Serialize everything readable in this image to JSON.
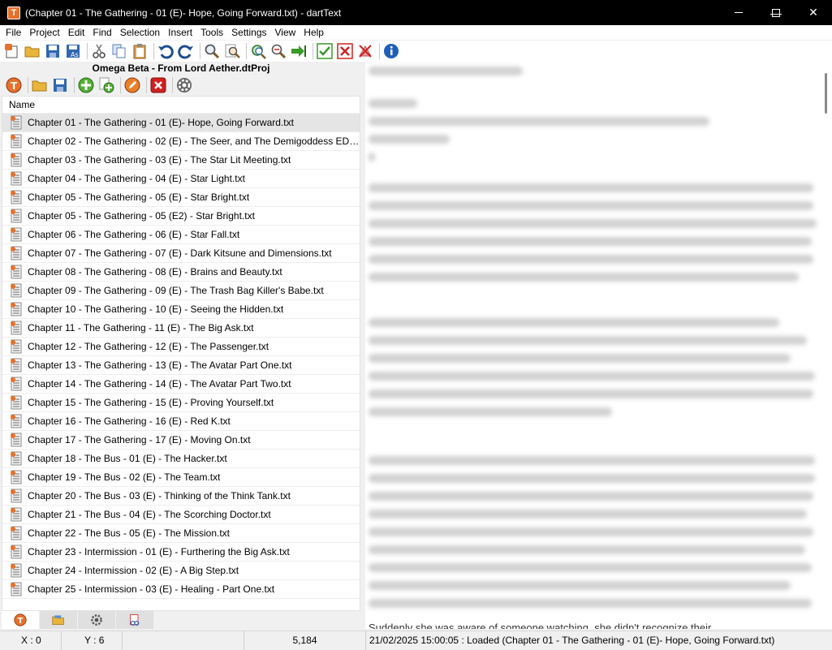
{
  "window": {
    "title": "(Chapter 01 - The Gathering - 01  (E)- Hope, Going Forward.txt) - dartText",
    "app_icon_letter": "T"
  },
  "menus": [
    "File",
    "Project",
    "Edit",
    "Find",
    "Selection",
    "Insert",
    "Tools",
    "Settings",
    "View",
    "Help"
  ],
  "project": {
    "title": "Omega Beta - From Lord Aether.dtProj",
    "column_header": "Name",
    "files": [
      "Chapter 01 - The Gathering - 01  (E)- Hope, Going Forward.txt",
      "Chapter 02 - The Gathering - 02 (E) - The Seer, and The Demigoddess EDITE...",
      "Chapter 03 - The Gathering - 03 (E) - The Star Lit Meeting.txt",
      "Chapter 04 - The Gathering - 04 (E) - Star Light.txt",
      "Chapter 05 - The Gathering - 05  (E) - Star Bright.txt",
      "Chapter 05 - The Gathering - 05  (E2) - Star Bright.txt",
      "Chapter 06 - The Gathering - 06 (E)  - Star Fall.txt",
      "Chapter 07 - The Gathering - 07  (E)  - Dark Kitsune and Dimensions.txt",
      "Chapter 08 - The Gathering - 08 (E)  - Brains and Beauty.txt",
      "Chapter 09 - The Gathering - 09 (E)  - The Trash Bag Killer's Babe.txt",
      "Chapter 10 - The Gathering - 10 (E)  - Seeing the Hidden.txt",
      "Chapter 11 - The Gathering - 11 (E)  - The Big Ask.txt",
      "Chapter 12 - The Gathering - 12 (E)  - The Passenger.txt",
      "Chapter 13 - The Gathering - 13 (E)  - The Avatar Part One.txt",
      "Chapter 14 - The Gathering - 14  (E) - The Avatar Part Two.txt",
      "Chapter 15 - The Gathering - 15 (E)  - Proving Yourself.txt",
      "Chapter 16 - The Gathering - 16  (E) - Red K.txt",
      "Chapter 17 - The Gathering - 17 (E)  - Moving On.txt",
      "Chapter 18 - The Bus - 01 (E)  - The Hacker.txt",
      "Chapter 19 - The Bus - 02 (E)  - The Team.txt",
      "Chapter 20 - The Bus - 03 (E)  - Thinking of the Think Tank.txt",
      "Chapter 21 - The Bus - 04 (E)  - The Scorching Doctor.txt",
      "Chapter 22 - The Bus - 05  (E) - The Mission.txt",
      "Chapter 23 - Intermission - 01 (E)  - Furthering the Big Ask.txt",
      "Chapter 24 - Intermission - 02 (E) - A Big Step.txt",
      "Chapter 25 - Intermission - 03 (E)  - Healing - Part One.txt"
    ]
  },
  "editor": {
    "visible_last_line": "Suddenly she was aware of someone watching, she didn't recognize their"
  },
  "statusbar": {
    "x": "X : 0",
    "y": "Y : 6",
    "count": "5,184",
    "message": "21/02/2025 15:00:05 : Loaded (Chapter 01 - The Gathering - 01  (E)- Hope, Going Forward.txt)"
  },
  "colors": {
    "titlebar": "#000000",
    "accent_orange": "#e8702a",
    "selected_row": "#e5e5e5"
  }
}
